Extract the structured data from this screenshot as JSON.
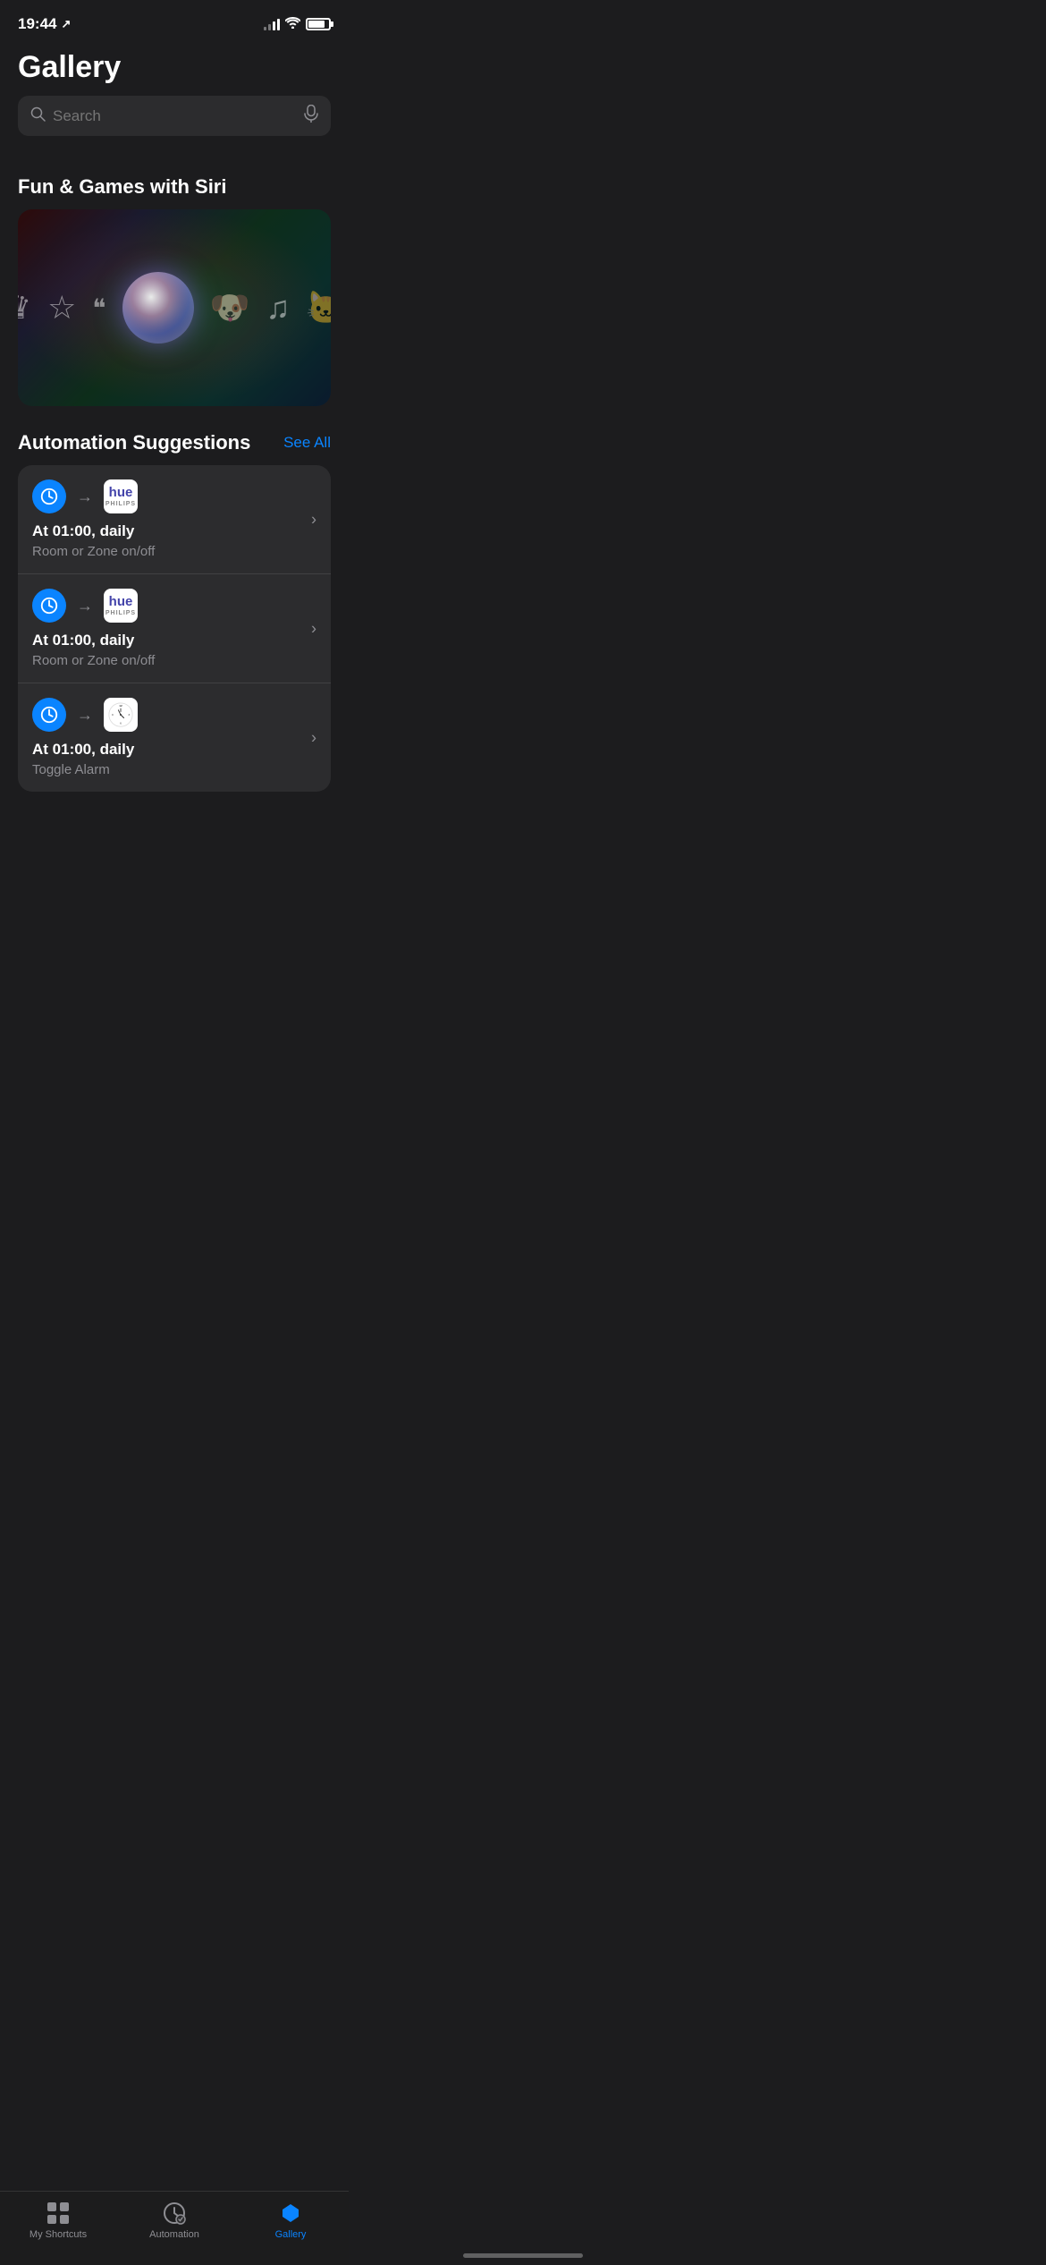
{
  "statusBar": {
    "time": "19:44",
    "locationArrow": "↗"
  },
  "header": {
    "title": "Gallery",
    "search": {
      "placeholder": "Search"
    }
  },
  "sections": {
    "funGames": {
      "title": "Fun & Games with Siri"
    },
    "automationSuggestions": {
      "title": "Automation Suggestions",
      "seeAll": "See All",
      "items": [
        {
          "time": "At 01:00, daily",
          "action": "Room or Zone on/off",
          "appName": "hue",
          "appSubtitle": "PHILIPS",
          "appType": "hue"
        },
        {
          "time": "At 01:00, daily",
          "action": "Room or Zone on/off",
          "appName": "hue",
          "appSubtitle": "PHILIPS",
          "appType": "hue"
        },
        {
          "time": "At 01:00, daily",
          "action": "Toggle Alarm",
          "appName": "Clock",
          "appType": "clock"
        }
      ]
    }
  },
  "tabBar": {
    "items": [
      {
        "label": "My Shortcuts",
        "icon": "grid",
        "active": false
      },
      {
        "label": "Automation",
        "icon": "clock-check",
        "active": false
      },
      {
        "label": "Gallery",
        "icon": "layers",
        "active": true
      }
    ]
  }
}
